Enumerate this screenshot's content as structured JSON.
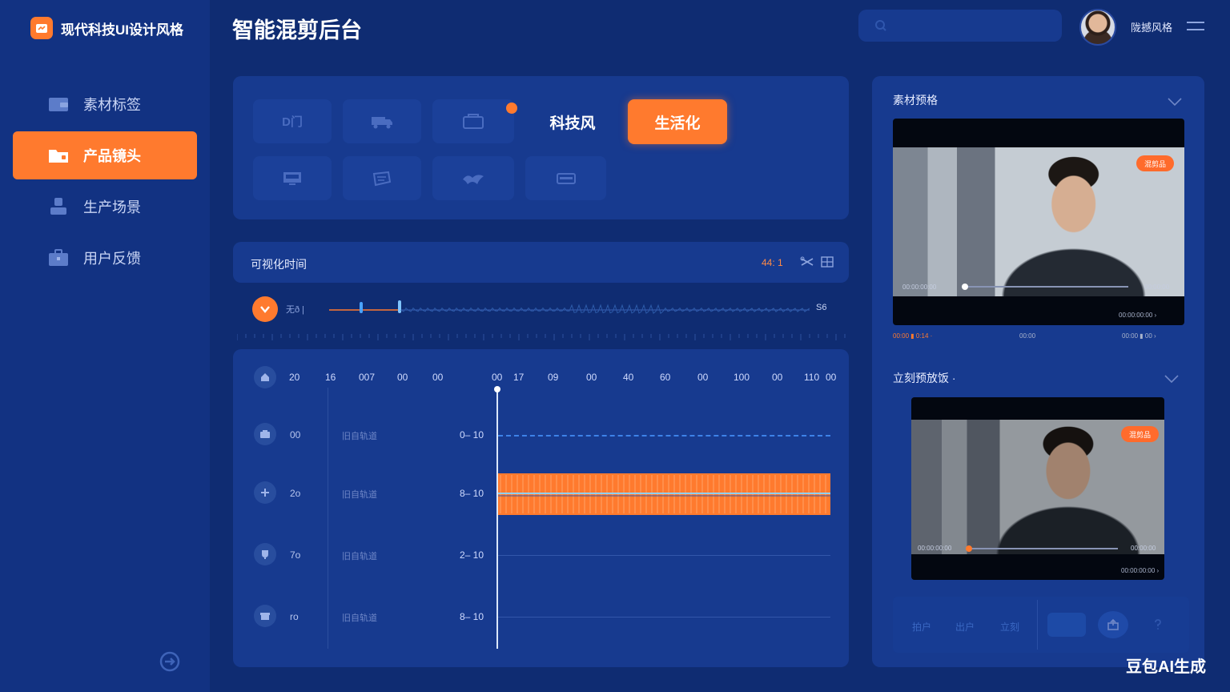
{
  "app": {
    "brand": "现代科技UI设计风格",
    "page_title": "智能混剪后台",
    "user_name": "陇撼风格",
    "watermark": "豆包AI生成"
  },
  "search": {
    "value": "",
    "placeholder": ""
  },
  "sidebar": {
    "items": [
      {
        "label": "素材标签",
        "icon": "wallet-icon",
        "active": false
      },
      {
        "label": "产品镜头",
        "icon": "folder-icon",
        "active": true
      },
      {
        "label": "生产场景",
        "icon": "stamp-icon",
        "active": false
      },
      {
        "label": "用户反馈",
        "icon": "briefcase-icon",
        "active": false
      }
    ]
  },
  "styles": {
    "tiles": [
      {
        "icon": "text-icon",
        "glyph": "D门"
      },
      {
        "icon": "truck-icon",
        "glyph": ""
      },
      {
        "icon": "box-icon",
        "glyph": "",
        "dot": true
      },
      {
        "icon": "monitor-icon",
        "glyph": ""
      },
      {
        "icon": "ticket-icon",
        "glyph": ""
      },
      {
        "icon": "bird-icon",
        "glyph": ""
      },
      {
        "icon": "card-icon",
        "glyph": ""
      }
    ],
    "text_tab": "科技风",
    "active_tab": "生活化"
  },
  "timeline": {
    "title": "可视化时间",
    "count": "44: 1",
    "playback_label": "无ð |",
    "playback_end": "S6",
    "ruler": [
      {
        "label": "20",
        "x": ""
      },
      {
        "label": "16"
      },
      {
        "label": "007"
      },
      {
        "label": "00"
      },
      {
        "label": "00"
      },
      {
        "label": "00"
      },
      {
        "label": "17"
      },
      {
        "label": "09"
      },
      {
        "label": "00"
      },
      {
        "label": "40"
      },
      {
        "label": "60"
      },
      {
        "label": "00"
      },
      {
        "label": "100"
      },
      {
        "label": "00"
      },
      {
        "label": "110"
      },
      {
        "label": "00"
      }
    ],
    "tracks": [
      {
        "num": "00",
        "name": "旧自轨道",
        "range": "0– 10",
        "style": "dashed",
        "icon": "camera-icon"
      },
      {
        "num": "2o",
        "name": "旧自轨道",
        "range": "8– 10",
        "style": "clip",
        "icon": "plus-icon"
      },
      {
        "num": "7o",
        "name": "旧自轨道",
        "range": "2– 10",
        "style": "line",
        "icon": "cup-icon"
      },
      {
        "num": "ro",
        "name": "旧自轨道",
        "range": "8– 10",
        "style": "line",
        "icon": "gift-icon"
      }
    ]
  },
  "preview1": {
    "title": "素材预格",
    "badge": "混剪品",
    "time_start": "00:00:00:00",
    "time_end": "00:00:00",
    "progress": 0.0,
    "caption": "00:00:00:00 ›",
    "meta": [
      "00:00 ▮ 0:14 ·",
      "00:00",
      "00:00 ▮ 00 ›"
    ]
  },
  "preview2": {
    "title": "立刻预放饭 ·",
    "badge": "混剪品",
    "time_start": "00:00:00:00",
    "time_end": "00:00:00",
    "progress": 0.02,
    "caption": "00:00:00:00 ›"
  },
  "controls": {
    "labels": [
      "拍户",
      "出户",
      "立刻"
    ]
  },
  "colors": {
    "accent": "#ff7a2e",
    "background": "#0f2c72",
    "panel": "#173a8f"
  }
}
